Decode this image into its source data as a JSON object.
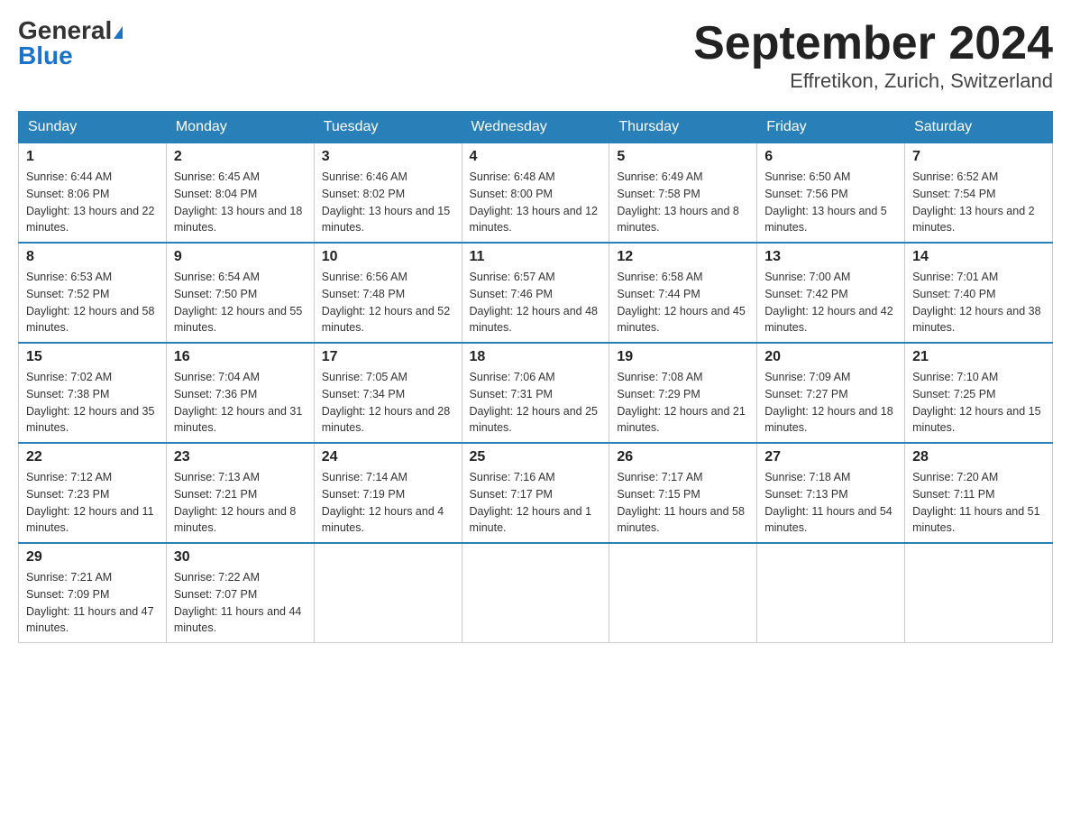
{
  "header": {
    "logo_general": "General",
    "logo_blue": "Blue",
    "month_title": "September 2024",
    "location": "Effretikon, Zurich, Switzerland"
  },
  "days_of_week": [
    "Sunday",
    "Monday",
    "Tuesday",
    "Wednesday",
    "Thursday",
    "Friday",
    "Saturday"
  ],
  "weeks": [
    [
      {
        "day": "1",
        "sunrise": "6:44 AM",
        "sunset": "8:06 PM",
        "daylight": "13 hours and 22 minutes."
      },
      {
        "day": "2",
        "sunrise": "6:45 AM",
        "sunset": "8:04 PM",
        "daylight": "13 hours and 18 minutes."
      },
      {
        "day": "3",
        "sunrise": "6:46 AM",
        "sunset": "8:02 PM",
        "daylight": "13 hours and 15 minutes."
      },
      {
        "day": "4",
        "sunrise": "6:48 AM",
        "sunset": "8:00 PM",
        "daylight": "13 hours and 12 minutes."
      },
      {
        "day": "5",
        "sunrise": "6:49 AM",
        "sunset": "7:58 PM",
        "daylight": "13 hours and 8 minutes."
      },
      {
        "day": "6",
        "sunrise": "6:50 AM",
        "sunset": "7:56 PM",
        "daylight": "13 hours and 5 minutes."
      },
      {
        "day": "7",
        "sunrise": "6:52 AM",
        "sunset": "7:54 PM",
        "daylight": "13 hours and 2 minutes."
      }
    ],
    [
      {
        "day": "8",
        "sunrise": "6:53 AM",
        "sunset": "7:52 PM",
        "daylight": "12 hours and 58 minutes."
      },
      {
        "day": "9",
        "sunrise": "6:54 AM",
        "sunset": "7:50 PM",
        "daylight": "12 hours and 55 minutes."
      },
      {
        "day": "10",
        "sunrise": "6:56 AM",
        "sunset": "7:48 PM",
        "daylight": "12 hours and 52 minutes."
      },
      {
        "day": "11",
        "sunrise": "6:57 AM",
        "sunset": "7:46 PM",
        "daylight": "12 hours and 48 minutes."
      },
      {
        "day": "12",
        "sunrise": "6:58 AM",
        "sunset": "7:44 PM",
        "daylight": "12 hours and 45 minutes."
      },
      {
        "day": "13",
        "sunrise": "7:00 AM",
        "sunset": "7:42 PM",
        "daylight": "12 hours and 42 minutes."
      },
      {
        "day": "14",
        "sunrise": "7:01 AM",
        "sunset": "7:40 PM",
        "daylight": "12 hours and 38 minutes."
      }
    ],
    [
      {
        "day": "15",
        "sunrise": "7:02 AM",
        "sunset": "7:38 PM",
        "daylight": "12 hours and 35 minutes."
      },
      {
        "day": "16",
        "sunrise": "7:04 AM",
        "sunset": "7:36 PM",
        "daylight": "12 hours and 31 minutes."
      },
      {
        "day": "17",
        "sunrise": "7:05 AM",
        "sunset": "7:34 PM",
        "daylight": "12 hours and 28 minutes."
      },
      {
        "day": "18",
        "sunrise": "7:06 AM",
        "sunset": "7:31 PM",
        "daylight": "12 hours and 25 minutes."
      },
      {
        "day": "19",
        "sunrise": "7:08 AM",
        "sunset": "7:29 PM",
        "daylight": "12 hours and 21 minutes."
      },
      {
        "day": "20",
        "sunrise": "7:09 AM",
        "sunset": "7:27 PM",
        "daylight": "12 hours and 18 minutes."
      },
      {
        "day": "21",
        "sunrise": "7:10 AM",
        "sunset": "7:25 PM",
        "daylight": "12 hours and 15 minutes."
      }
    ],
    [
      {
        "day": "22",
        "sunrise": "7:12 AM",
        "sunset": "7:23 PM",
        "daylight": "12 hours and 11 minutes."
      },
      {
        "day": "23",
        "sunrise": "7:13 AM",
        "sunset": "7:21 PM",
        "daylight": "12 hours and 8 minutes."
      },
      {
        "day": "24",
        "sunrise": "7:14 AM",
        "sunset": "7:19 PM",
        "daylight": "12 hours and 4 minutes."
      },
      {
        "day": "25",
        "sunrise": "7:16 AM",
        "sunset": "7:17 PM",
        "daylight": "12 hours and 1 minute."
      },
      {
        "day": "26",
        "sunrise": "7:17 AM",
        "sunset": "7:15 PM",
        "daylight": "11 hours and 58 minutes."
      },
      {
        "day": "27",
        "sunrise": "7:18 AM",
        "sunset": "7:13 PM",
        "daylight": "11 hours and 54 minutes."
      },
      {
        "day": "28",
        "sunrise": "7:20 AM",
        "sunset": "7:11 PM",
        "daylight": "11 hours and 51 minutes."
      }
    ],
    [
      {
        "day": "29",
        "sunrise": "7:21 AM",
        "sunset": "7:09 PM",
        "daylight": "11 hours and 47 minutes."
      },
      {
        "day": "30",
        "sunrise": "7:22 AM",
        "sunset": "7:07 PM",
        "daylight": "11 hours and 44 minutes."
      },
      null,
      null,
      null,
      null,
      null
    ]
  ]
}
